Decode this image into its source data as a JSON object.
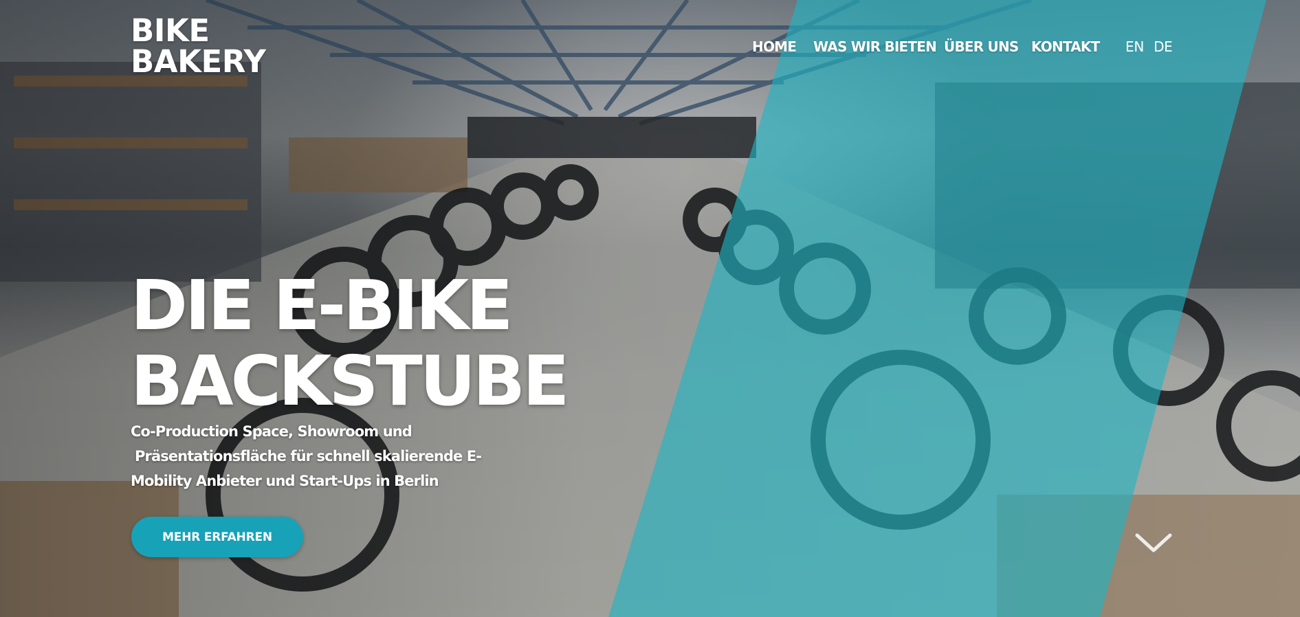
{
  "logo": {
    "line1": "BIKE",
    "line2": "BAKERY"
  },
  "nav": {
    "items": [
      {
        "label": "HOME"
      },
      {
        "label": "WAS WIR BIETEN"
      },
      {
        "label": "ÜBER UNS"
      },
      {
        "label": "KONTAKT"
      }
    ],
    "languages": [
      "EN",
      "DE"
    ]
  },
  "hero": {
    "headline_line1": "DIE E-BIKE",
    "headline_line2": "BACKSTUBE",
    "subtext_line1": "Co-Production Space, Showroom und",
    "subtext_line2": "Präsentationsfläche für schnell skalierende E-",
    "subtext_line3": "Mobility Anbieter und Start-Ups in Berlin",
    "cta_label": "MEHR ERFAHREN",
    "scroll_icon": "chevron-down-icon"
  },
  "colors": {
    "accent": "#17a2b8",
    "teal_overlay": "#1fb5c4",
    "text": "#ffffff"
  }
}
